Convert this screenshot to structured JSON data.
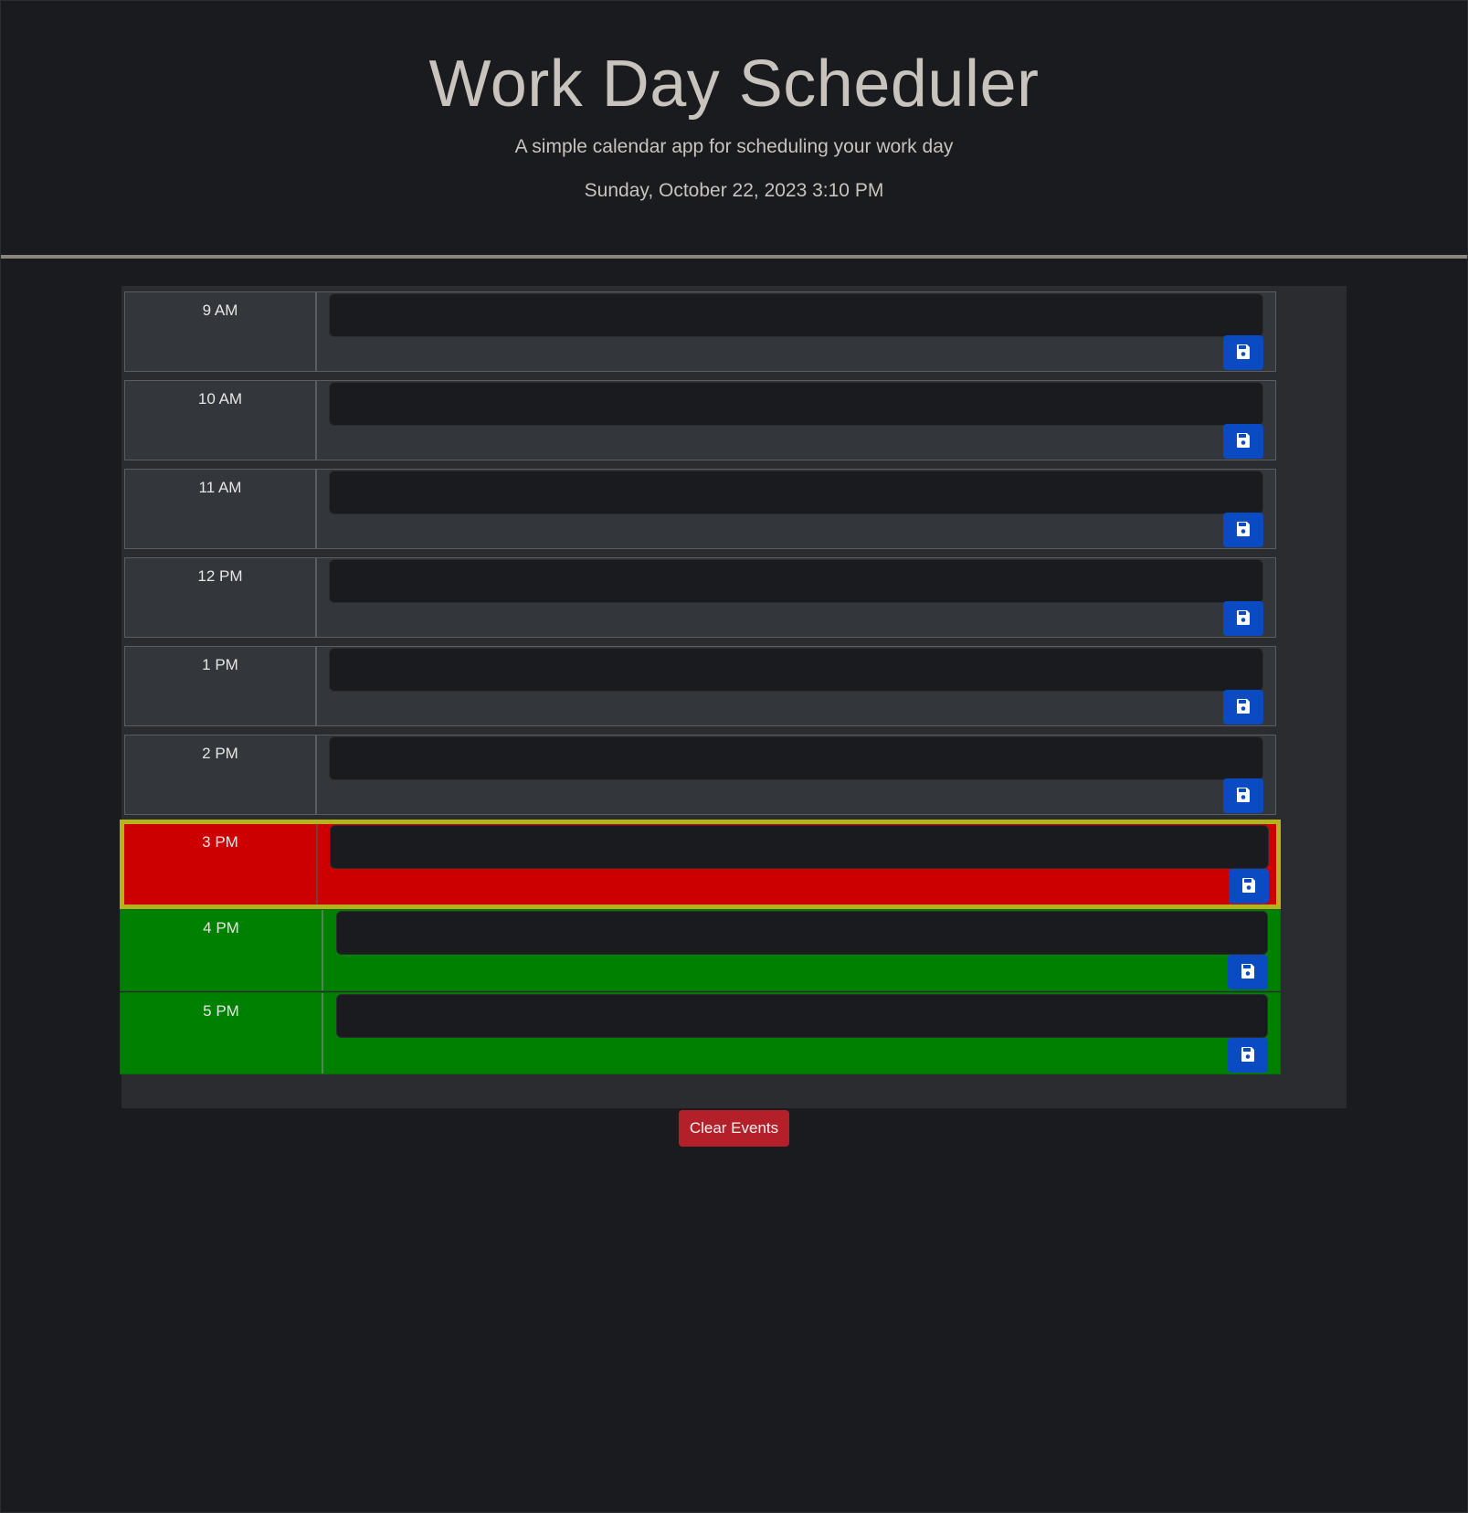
{
  "header": {
    "title": "Work Day Scheduler",
    "subtitle": "A simple calendar app for scheduling your work day",
    "current_datetime": "Sunday, October 22, 2023 3:10 PM"
  },
  "colors": {
    "past": "#33363a",
    "present": "#cc0000",
    "present_border": "#b5b21a",
    "future": "#008000",
    "save_button": "#0a4bc4",
    "clear_button": "#b3202a",
    "background": "#1a1b1e"
  },
  "time_blocks": [
    {
      "hour": "9 AM",
      "status": "past",
      "event_text": "",
      "save_icon": "floppy-disk-icon"
    },
    {
      "hour": "10 AM",
      "status": "past",
      "event_text": "",
      "save_icon": "floppy-disk-icon"
    },
    {
      "hour": "11 AM",
      "status": "past",
      "event_text": "",
      "save_icon": "floppy-disk-icon"
    },
    {
      "hour": "12 PM",
      "status": "past",
      "event_text": "",
      "save_icon": "floppy-disk-icon"
    },
    {
      "hour": "1 PM",
      "status": "past",
      "event_text": "",
      "save_icon": "floppy-disk-icon"
    },
    {
      "hour": "2 PM",
      "status": "past",
      "event_text": "",
      "save_icon": "floppy-disk-icon"
    },
    {
      "hour": "3 PM",
      "status": "present",
      "event_text": "",
      "save_icon": "floppy-disk-icon"
    },
    {
      "hour": "4 PM",
      "status": "future",
      "event_text": "",
      "save_icon": "floppy-disk-icon"
    },
    {
      "hour": "5 PM",
      "status": "future",
      "event_text": "",
      "save_icon": "floppy-disk-icon"
    }
  ],
  "clear_button_label": "Clear Events"
}
